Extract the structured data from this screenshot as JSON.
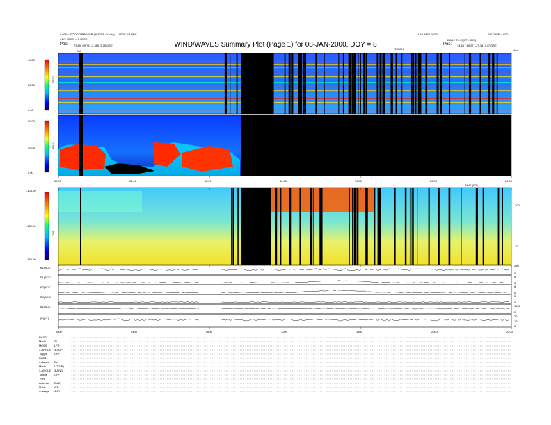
{
  "header": {
    "title": "WIND/WAVES Summary Plot (Page 1) for 08-JAN-2000, DOY = 8",
    "left_line1": "0.026 = DOOOO BPOSSP (903003) (Y.col/y) - LWOC FB BPC",
    "left_line2": "ARG FREG = 1.00 E01",
    "left_pos_label": "Pos:",
    "left_pos_value": "73.85( 09.78, -2.385, 3.25 GSE)",
    "right_line1": "1.10 WED 20702",
    "right_line2": "DAILY T0.10(071, 30X)",
    "right_pos_label": "Pos:",
    "right_pos_value": "74.65 ( 89.27, -27.78, 7.47 GSE)",
    "right_corner": "L 5 ETOOE = 80D",
    "cal_marker": "Cal",
    "mid_marker": "TELEN",
    "hz_marker": "kHz",
    "mid_scale_marker": "kHz"
  },
  "chart_data": [
    {
      "type": "heatmap",
      "panel": "RAD2",
      "ylabel": "RAD2",
      "yticks": [
        "40.00",
        "20.00",
        "0.00"
      ],
      "note": "dynamic spectrum; data gap between ~14:00 and ~15:30 (black)",
      "data_gaps_hours": [
        [
          7.5,
          8.65
        ]
      ],
      "dense_gaps_region_hours": [
        8.65,
        24.0
      ]
    },
    {
      "type": "heatmap",
      "panel": "RAD1",
      "ylabel": "RAD1",
      "yticks": [
        "50.00",
        "30.00",
        "0.00"
      ],
      "data_gaps_hours": [
        [
          7.5,
          24.0
        ]
      ]
    },
    {
      "type": "heatmap",
      "panel": "TNR",
      "ylabel": "TNR",
      "yticks": [
        "-105.00",
        "-130.00",
        "-155.00"
      ],
      "right_ticks": [
        "100",
        "10"
      ],
      "data_gaps_hours": [
        [
          7.5,
          8.65
        ]
      ]
    },
    {
      "type": "line",
      "panels": [
        {
          "label": "B1(ADC)",
          "right_ticks": [
            "250",
            "0"
          ]
        },
        {
          "label": "E1(ADC)",
          "right_ticks": [
            "5",
            "0"
          ]
        },
        {
          "label": "E2(ADC)",
          "right_ticks": [
            "5",
            "0"
          ]
        },
        {
          "label": "B0(ADC)",
          "right_ticks": [
            "5",
            "0"
          ]
        },
        {
          "label": "A1(ADC)",
          "right_ticks": [
            "1000",
            "0"
          ]
        },
        {
          "label": "|B|(nT)",
          "right_ticks": [
            "20",
            "10",
            "0"
          ]
        }
      ]
    }
  ],
  "time_axis": {
    "upper_ticks": [
      "00:00",
      "04:00",
      "08:00",
      "12:00",
      "16:00",
      "20:00",
      "24:00"
    ],
    "lower_ticks": [
      "0000",
      "0400",
      "0800",
      "1200",
      "1600",
      "2000",
      "2400"
    ],
    "xlim_hours": [
      0,
      24
    ],
    "mid_label": "TIME (UT)"
  },
  "footer": {
    "rad2_title": "RAD2",
    "rad2_rows": [
      {
        "k": "Mode",
        "v": "SL"
      },
      {
        "k": "MODE",
        "v": "LFR"
      },
      {
        "k": "3-ANGLE",
        "v": "3-SUP"
      },
      {
        "k": "Toggle",
        "v": "OFF"
      }
    ],
    "rad1_title": "RAD1",
    "rad1_rows": [
      {
        "k": "Antenna",
        "v": "Ex"
      },
      {
        "k": "Mode",
        "v": "LOG(P)"
      },
      {
        "k": "3-ANGLE",
        "v": "3-ANG"
      },
      {
        "k": "Toggle",
        "v": "OFF"
      }
    ],
    "tnr_title": "TNR",
    "tnr_rows": [
      {
        "k": "Antenna",
        "v": "Ex/Ey"
      },
      {
        "k": "Mode",
        "v": "A/B"
      },
      {
        "k": "Average",
        "v": "AVG"
      }
    ]
  }
}
